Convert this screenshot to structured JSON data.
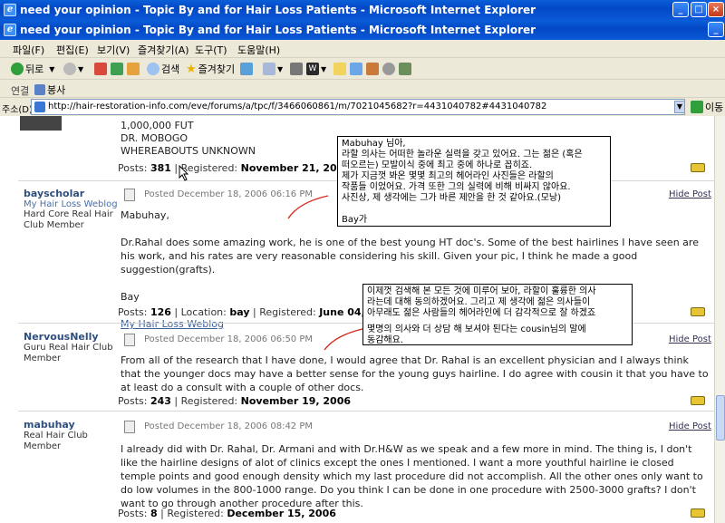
{
  "window_back": {
    "title": "need your opinion - Topic By and for Hair Loss Patients - Microsoft Internet Explorer"
  },
  "window": {
    "title": "need your opinion - Topic By and for Hair Loss Patients - Microsoft Internet Explorer"
  },
  "menu": [
    "파일(F)",
    "편집(E)",
    "보기(V)",
    "즐겨찾기(A)",
    "도구(T)",
    "도움말(H)"
  ],
  "toolbar": {
    "back": "뒤로",
    "search": "검색",
    "favorites": "즐겨찾기"
  },
  "links": {
    "label": "연결",
    "item": "봉사"
  },
  "address": {
    "label": "주소(D)",
    "url": "http://hair-restoration-info.com/eve/forums/a/tpc/f/3466060861/m/7021045682?r=4431040782#4431040782",
    "go": "이동"
  },
  "top_post": {
    "lines": [
      "1,000,000 FUT",
      "DR. MOBOGO",
      "WHEREABOUTS UNKNOWN"
    ],
    "posts_label": "Posts:",
    "posts": "381",
    "registered_label": "Registered:",
    "registered": "November 21, 2006"
  },
  "posts": [
    {
      "username": "bayscholar",
      "weblog": "My Hair Loss Weblog",
      "rank": [
        "Hard Core Real Hair",
        "Club Member"
      ],
      "posted": "Posted December 18, 2006 06:16 PM",
      "hide": "Hide Post",
      "body": [
        "Mabuhay,",
        "Dr.Rahal does some amazing work, he is one of the best young HT doc's. Some of the best hairlines I have seen are his work, and his rates are very reasonable considering his skill. Given your pic, I think he made a good suggestion(grafts).",
        "Bay"
      ],
      "link": "My Hair Loss Weblog",
      "posts_label": "Posts:",
      "posts": "126",
      "location_label": "Location:",
      "location": "bay",
      "registered_label": "Registered:",
      "registered": "June 04, 2006"
    },
    {
      "username": "NervousNelly",
      "rank": [
        "Guru Real Hair Club",
        "Member"
      ],
      "posted": "Posted December 18, 2006 06:50 PM",
      "hide": "Hide Post",
      "body": [
        "From all of the research that I have done, I would agree that Dr. Rahal is an excellent physician and I always think that the younger docs may have a better sense for the young guys hairline. I do agree with cousin it that you have to at least do a consult with a couple of other docs."
      ],
      "posts_label": "Posts:",
      "posts": "243",
      "registered_label": "Registered:",
      "registered": "November 19, 2006"
    },
    {
      "username": "mabuhay",
      "rank": [
        "Real Hair Club",
        "Member"
      ],
      "posted": "Posted December 18, 2006 08:42 PM",
      "hide": "Hide Post",
      "body": [
        "I already did with Dr. Rahal, Dr. Armani and with Dr.H&W as we speak and a few more in mind. The thing is, I don't like the hairline designs of alot of clinics except the ones I mentioned. I want a more youthful hairline ie closed temple points and good enough density which my last procedure did not accomplish. All the other ones only want to do low volumes in the 800-1000 range. Do you think I can be done in one procedure with 2500-3000 grafts? I don't want to go through another procedure after this."
      ],
      "posts_label": "Posts:",
      "posts": "8",
      "registered_label": "Registered:",
      "registered": "December 15, 2006"
    }
  ],
  "note1": [
    "Mabuhay 님아,",
    "라할 의사는 어떠한 놀라운 실력을 갖고 있어요. 그는 젊은 (혹은",
    "떠오르는) 모발이식 중에 최고 중에 하나로 꼽히죠.",
    "제가 지금껏 봐온 몇몇 최고의 헤어라인 사진들은 라할의",
    "작품들 이었어요. 가격 또한 그의 실력에 비해 비싸지 않아요.",
    "사진상, 제 생각에는 그가 바른 제안을 한 것 같아요.(모낭)",
    "",
    "Bay가"
  ],
  "note2": [
    "이제껏 검색해 본 모든 것에 미루어 보아, 라할이 훌륭한 의사",
    "라는데 대해 동의하겠어요. 그리고 제 생각에 젊은 의사들이",
    "아무래도 젊은 사람들의 헤어라인에 더 감각적으로 잘 하겠죠",
    "",
    "몇명의 의사와 더 상담 해 보셔야 된다는 cousin님의 말에",
    "동감해요."
  ]
}
